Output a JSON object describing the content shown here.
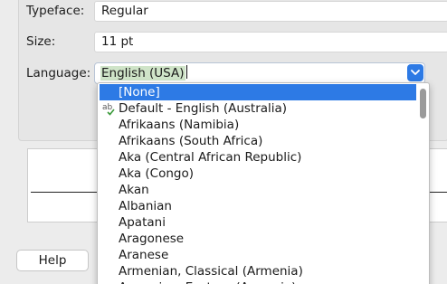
{
  "form": {
    "typeface_label": "Typeface:",
    "typeface_value": "Regular",
    "size_label": "Size:",
    "size_value": "11 pt",
    "language_label": "Language:",
    "language_value": "English (USA)"
  },
  "footer": {
    "help_label": "Help"
  },
  "language_list": {
    "items": [
      "[None]",
      "Default - English (Australia)",
      "Afrikaans (Namibia)",
      "Afrikaans (South Africa)",
      "Aka (Central African Republic)",
      "Aka (Congo)",
      "Akan",
      "Albanian",
      "Apatani",
      "Aragonese",
      "Aranese",
      "Armenian, Classical (Armenia)",
      "Armenian, Eastern (Armenia)"
    ],
    "selected_index": 0,
    "spellcheck_icon_index": 1
  },
  "colors": {
    "accent": "#2d7ae5",
    "language_highlight": "#cfe4c8"
  }
}
